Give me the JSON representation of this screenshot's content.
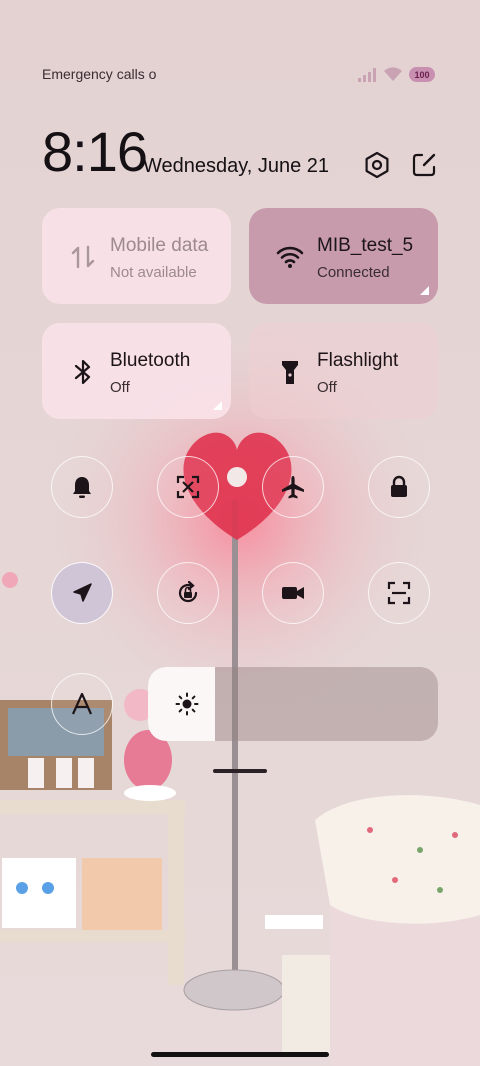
{
  "status": {
    "carrier_text": "Emergency calls o",
    "battery": "100"
  },
  "clock": {
    "time": "8:16",
    "date": "Wednesday, June 21"
  },
  "tiles": [
    {
      "title": "Mobile data",
      "subtitle": "Not available",
      "icon": "mobile-data-icon",
      "state": "disabled"
    },
    {
      "title": "MIB_test_5",
      "subtitle": "Connected",
      "icon": "wifi-icon",
      "state": "on"
    },
    {
      "title": "Bluetooth",
      "subtitle": "Off",
      "icon": "bluetooth-icon",
      "state": "off"
    },
    {
      "title": "Flashlight",
      "subtitle": "Off",
      "icon": "flashlight-icon",
      "state": "off"
    }
  ],
  "toggles": [
    {
      "icon": "bell-icon",
      "state": "off"
    },
    {
      "icon": "screenshot-icon",
      "state": "off"
    },
    {
      "icon": "airplane-icon",
      "state": "off"
    },
    {
      "icon": "lock-icon",
      "state": "off"
    },
    {
      "icon": "location-icon",
      "state": "on"
    },
    {
      "icon": "rotation-lock-icon",
      "state": "off"
    },
    {
      "icon": "video-camera-icon",
      "state": "off"
    },
    {
      "icon": "scan-icon",
      "state": "off"
    },
    {
      "icon": "auto-brightness-icon",
      "state": "off"
    }
  ],
  "brightness": {
    "level": 0.23,
    "icon": "sun-icon"
  },
  "colors": {
    "accent_tile": "#c496a8",
    "light_tile": "#f8e2e8",
    "active_toggle": "#cdc3d7"
  }
}
